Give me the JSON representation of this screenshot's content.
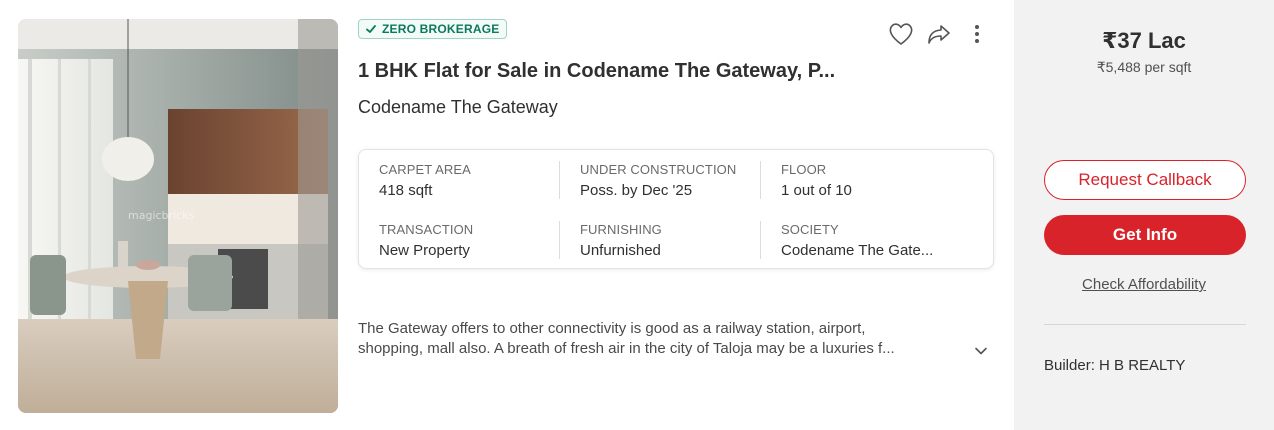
{
  "listing": {
    "badge": "ZERO BROKERAGE",
    "title": "1 BHK Flat for Sale in Codename The Gateway, P...",
    "project": "Codename The Gateway",
    "icons": [
      "heart-icon",
      "share-icon",
      "more-vertical-icon"
    ],
    "summary": [
      {
        "label": "CARPET AREA",
        "value": "418 sqft"
      },
      {
        "label": "UNDER CONSTRUCTION",
        "value": "Poss. by Dec '25"
      },
      {
        "label": "FLOOR",
        "value": "1 out of 10"
      },
      {
        "label": "TRANSACTION",
        "value": "New Property"
      },
      {
        "label": "FURNISHING",
        "value": "Unfurnished"
      },
      {
        "label": "SOCIETY",
        "value": "Codename The Gate..."
      }
    ],
    "description_line1": "The Gateway offers to other connectivity is good as a railway station, airport,",
    "description_line2": "shopping, mall also. A breath of fresh air in the city of Taloja may be a luxuries f..."
  },
  "pricing": {
    "price": "₹37 Lac",
    "per_sqft": "₹5,488 per sqft",
    "request_callback": "Request Callback",
    "get_info": "Get Info",
    "check_affordability": "Check Affordability",
    "builder": "Builder: H B REALTY"
  },
  "colors": {
    "accent": "#d8232a",
    "badge_green": "#0c7a5a",
    "panel_bg": "#f2f2f2"
  }
}
